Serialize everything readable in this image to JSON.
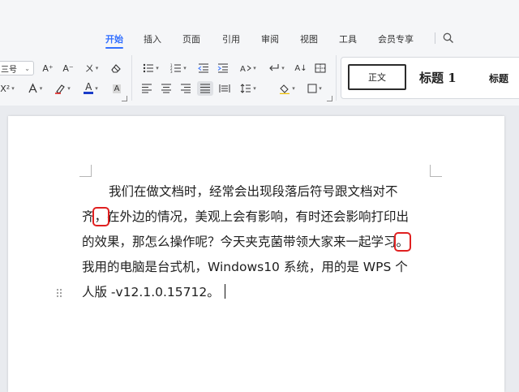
{
  "tabs": [
    {
      "label": "开始",
      "active": true
    },
    {
      "label": "插入",
      "active": false
    },
    {
      "label": "页面",
      "active": false
    },
    {
      "label": "引用",
      "active": false
    },
    {
      "label": "审阅",
      "active": false
    },
    {
      "label": "视图",
      "active": false
    },
    {
      "label": "工具",
      "active": false
    },
    {
      "label": "会员专享",
      "active": false
    }
  ],
  "ribbon": {
    "font_size": "三号",
    "grow_font_label": "A⁺",
    "shrink_font_label": "A⁻",
    "phonetic_label": "ㄨ",
    "superscript_label": "X²",
    "font_color_label": "A",
    "char_shading_label": "A",
    "sort_label": "A↓"
  },
  "styles": {
    "normal": "正文",
    "heading1": "标题 1",
    "heading2": "标题"
  },
  "document": {
    "lines": [
      {
        "before": "我们在做文档时，经常会出现段落后符号跟文档对不",
        "mark": "",
        "after": ""
      },
      {
        "before": "齐",
        "mark": "，",
        "after": "在外边的情况，美观上会有影响，有时还会影响打印出"
      },
      {
        "before": "的效果，那怎么操作呢？今天夹克菌带领大家来一起学习",
        "mark": "。",
        "after": ""
      },
      {
        "before": "我用的电脑是台式机，Windows10 系统，用的是 WPS 个",
        "mark": "",
        "after": ""
      },
      {
        "before": "人版  -v12.1.0.15712。",
        "mark": "",
        "after": ""
      }
    ]
  },
  "colors": {
    "accent": "#3370ff",
    "highlight_box": "#e02020",
    "font_color_bar": "#1a3cc8"
  }
}
